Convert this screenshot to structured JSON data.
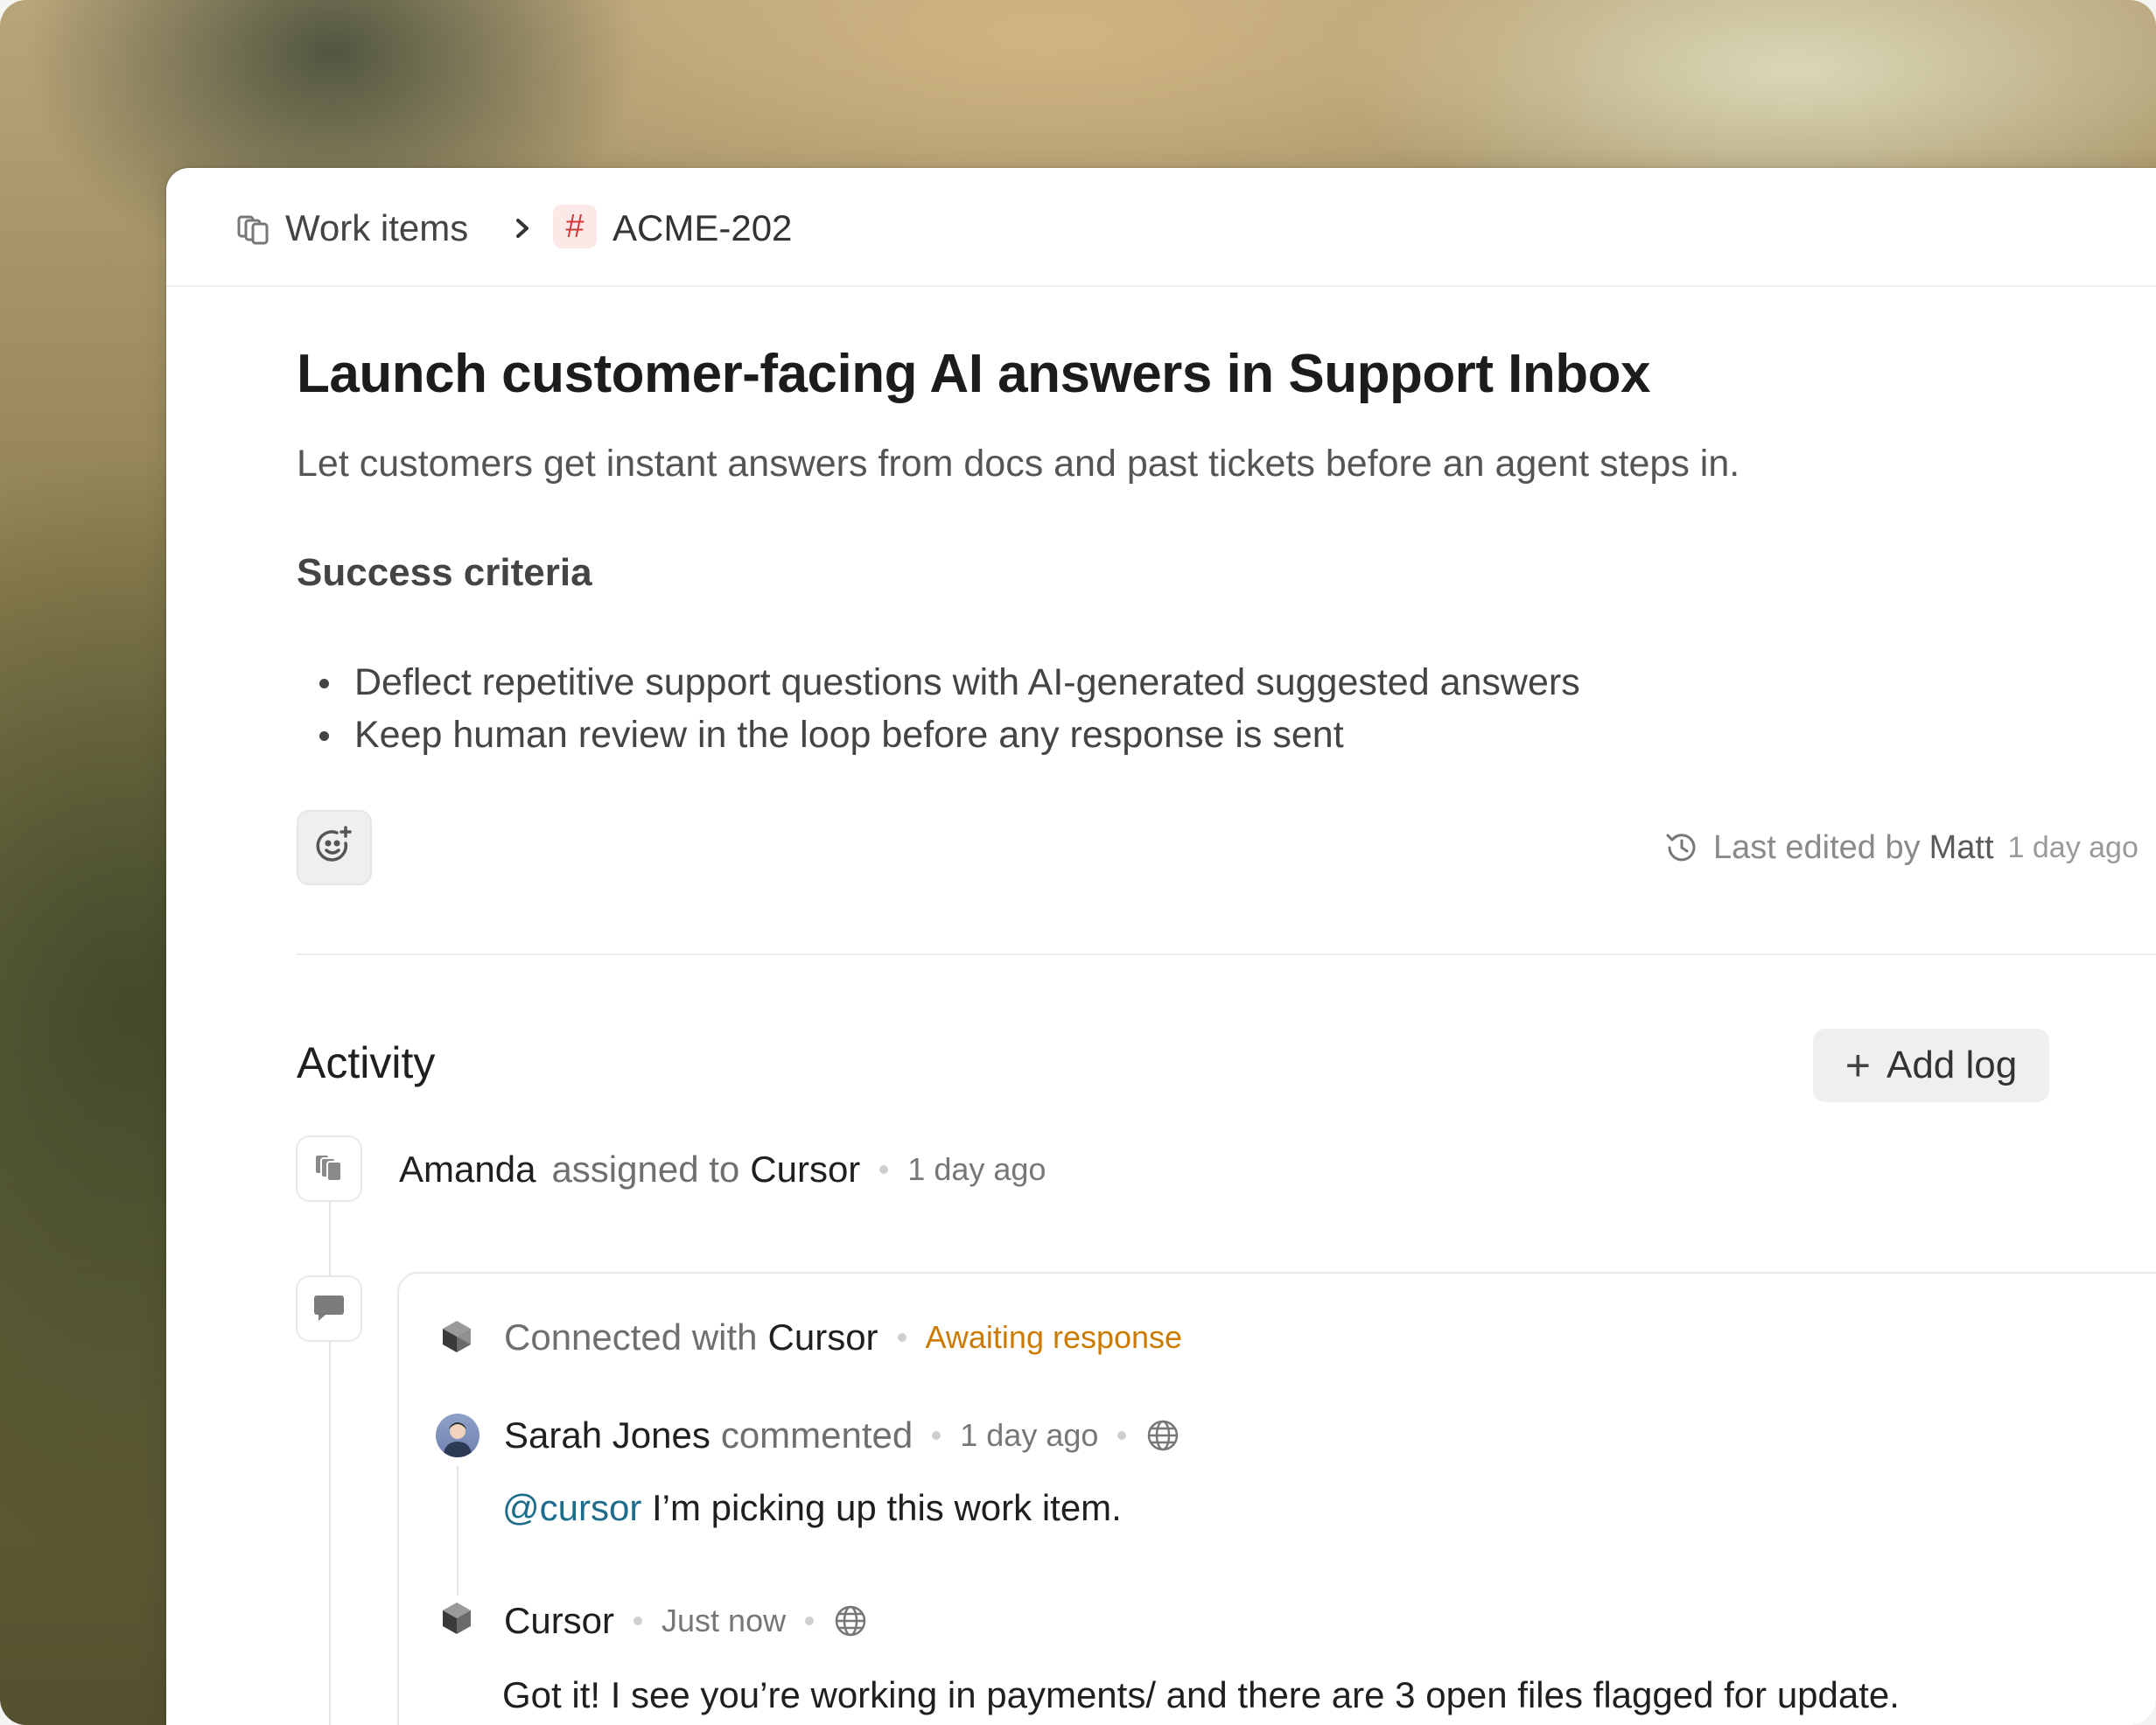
{
  "breadcrumb": {
    "parent_label": "Work items",
    "separator": "›",
    "hash_symbol": "#",
    "item_id": "ACME-202"
  },
  "item": {
    "title": "Launch customer-facing AI answers in Support Inbox",
    "description": "Let customers get instant answers from docs and past tickets before an agent steps in.",
    "section_heading": "Success criteria",
    "criteria": [
      "Deflect repetitive support questions with AI-generated suggested answers",
      "Keep human review in the loop before any response is sent"
    ],
    "last_edited": {
      "prefix": "Last edited by",
      "by": "Matt",
      "when": "1 day ago"
    }
  },
  "activity": {
    "heading": "Activity",
    "add_log_icon": "+",
    "add_log_label": "Add log",
    "events": [
      {
        "actor": "Amanda",
        "action": "assigned to",
        "target": "Cursor",
        "time": "1 day ago"
      }
    ],
    "thread": {
      "connected_prefix": "Connected with",
      "connected_app": "Cursor",
      "status": "Awaiting response",
      "comments": [
        {
          "author": "Sarah Jones",
          "verb": "commented",
          "time": "1 day ago",
          "mention": "@cursor",
          "text": "I’m picking up this work item."
        },
        {
          "author": "Cursor",
          "time": "Just now",
          "text": "Got it! I see you’re working in payments/ and there are 3 open files flagged for update."
        }
      ]
    }
  },
  "colors": {
    "accent_hash_bg": "#fde8e8",
    "accent_hash_fg": "#d23a3a",
    "status_awaiting": "#cc7b00",
    "mention": "#1f6d8c"
  },
  "icons": {
    "breadcrumb_parent": "work-items-icon",
    "reaction": "add-reaction-icon",
    "history": "history-clock-icon",
    "assign_event": "work-items-icon",
    "comment_event": "speech-bubble-icon",
    "cursor_logo": "cursor-cube-icon",
    "visibility": "globe-icon"
  }
}
